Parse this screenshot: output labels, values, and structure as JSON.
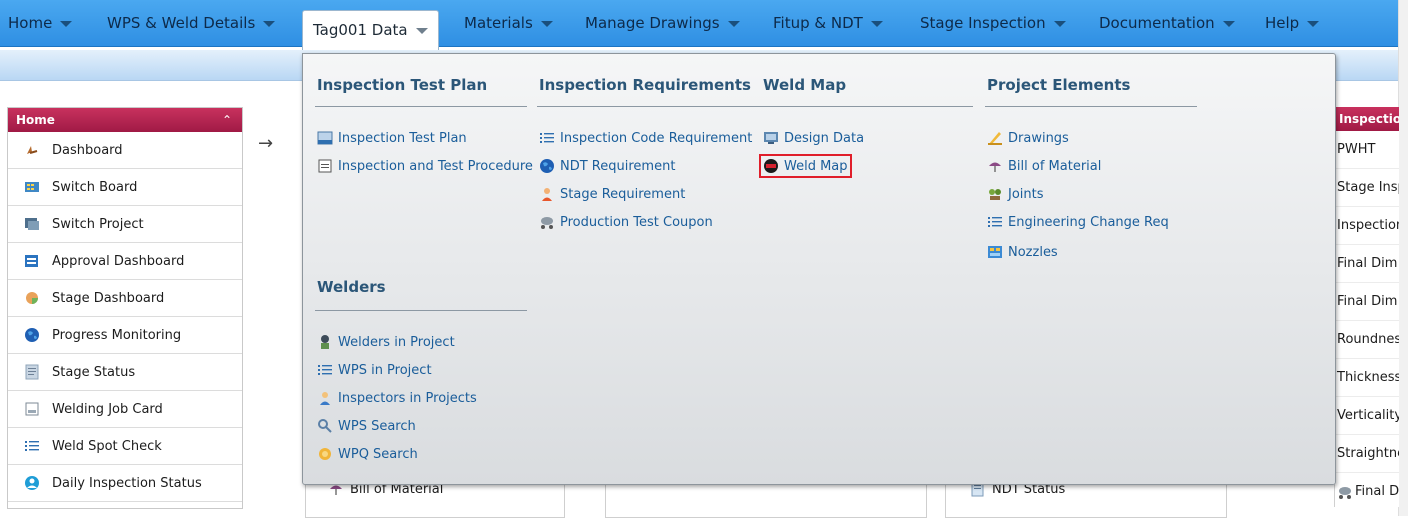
{
  "nav": {
    "items": [
      {
        "label": "Home"
      },
      {
        "label": "WPS & Weld Details"
      },
      {
        "label": "Tag001 Data"
      },
      {
        "label": "Materials"
      },
      {
        "label": "Manage Drawings"
      },
      {
        "label": "Fitup & NDT"
      },
      {
        "label": "Stage Inspection"
      },
      {
        "label": "Documentation"
      },
      {
        "label": "Help"
      }
    ],
    "active": "Tag001 Data"
  },
  "left_panel": {
    "title": "Home",
    "collapse_glyph": "»",
    "items": [
      {
        "label": "Dashboard",
        "icon": "dashboard-icon"
      },
      {
        "label": "Switch Board",
        "icon": "switch-board-icon"
      },
      {
        "label": "Switch Project",
        "icon": "switch-project-icon"
      },
      {
        "label": "Approval Dashboard",
        "icon": "approval-icon"
      },
      {
        "label": "Stage Dashboard",
        "icon": "stage-dashboard-icon"
      },
      {
        "label": "Progress Monitoring",
        "icon": "globe-icon"
      },
      {
        "label": "Stage Status",
        "icon": "stage-status-icon"
      },
      {
        "label": "Welding Job Card",
        "icon": "job-card-icon"
      },
      {
        "label": "Weld Spot Check",
        "icon": "list-icon"
      },
      {
        "label": "Daily Inspection Status",
        "icon": "inspection-status-icon"
      }
    ]
  },
  "arrow_glyph": "→",
  "background_rows": {
    "bill_of_material": "Bill of Material",
    "ndt_status": "NDT Status"
  },
  "right_panel": {
    "title": "Inspection",
    "items": [
      "PWHT",
      "Stage Insp",
      "Inspection",
      "Final Dim",
      "Final Dim",
      "Roundnes",
      "Thickness",
      "Verticality",
      "Straightne",
      "Final Dim"
    ]
  },
  "megamenu": {
    "inspection_test_plan": {
      "heading": "Inspection Test Plan",
      "links": [
        "Inspection Test Plan",
        "Inspection and Test Procedure"
      ]
    },
    "inspection_requirements": {
      "heading": "Inspection Requirements",
      "links": [
        "Inspection Code Requirement",
        "NDT Requirement",
        "Stage Requirement",
        "Production Test Coupon"
      ]
    },
    "weld_map": {
      "heading": "Weld Map",
      "links": [
        "Design Data",
        "Weld Map"
      ],
      "highlighted": "Weld Map"
    },
    "project_elements": {
      "heading": "Project Elements",
      "links": [
        "Drawings",
        "Bill of Material",
        "Joints",
        "Engineering Change Req",
        "Nozzles"
      ]
    },
    "welders": {
      "heading": "Welders",
      "links": [
        "Welders in Project",
        "WPS in Project",
        "Inspectors in Projects",
        "WPS Search",
        "WPQ Search"
      ]
    }
  },
  "colors": {
    "nav_blue": "#3a9bea",
    "panel_header": "#b3234f",
    "link_blue": "#1a5d9a",
    "highlight_red": "#e01e2a"
  }
}
